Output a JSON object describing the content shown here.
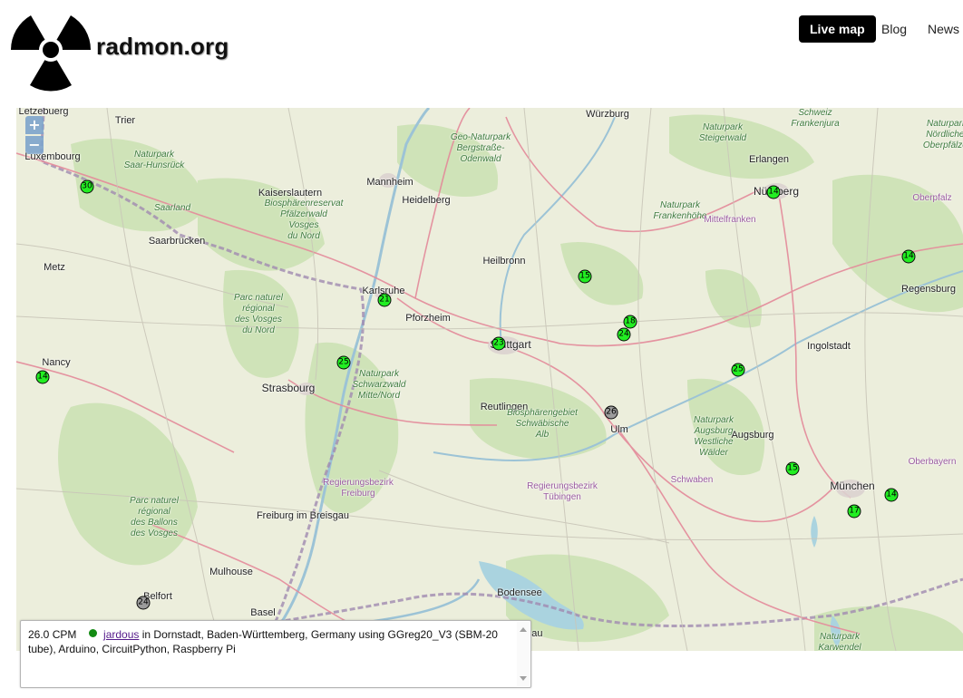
{
  "header": {
    "site_title": "radmon.org",
    "logo_icon": "radiation-trefoil-icon",
    "nav": [
      {
        "label": "Live map",
        "active": true
      },
      {
        "label": "Blog",
        "active": false
      },
      {
        "label": "News",
        "active": false
      }
    ]
  },
  "map": {
    "zoom_in_label": "+",
    "zoom_out_label": "−",
    "labels": [
      {
        "text": "Luxembourg",
        "kind": "city"
      },
      {
        "text": "Trier",
        "kind": "city"
      },
      {
        "text": "Würzburg",
        "kind": "city"
      },
      {
        "text": "Naturpark\nSaar-Hunsrück",
        "kind": "park"
      },
      {
        "text": "Saarland",
        "kind": "park"
      },
      {
        "text": "Geo-Naturpark\nBergstraße-\nOdenwald",
        "kind": "park"
      },
      {
        "text": "Kaiserslautern",
        "kind": "city"
      },
      {
        "text": "Mannheim",
        "kind": "city"
      },
      {
        "text": "Heidelberg",
        "kind": "city"
      },
      {
        "text": "Biosphärenreservat\nPfälzerwald\nVosges\ndu Nord",
        "kind": "park"
      },
      {
        "text": "Saarbrücken",
        "kind": "city"
      },
      {
        "text": "Metz",
        "kind": "city"
      },
      {
        "text": "Heilbronn",
        "kind": "city"
      },
      {
        "text": "Parc naturel\nrégional\ndes Vosges\ndu Nord",
        "kind": "park"
      },
      {
        "text": "Karlsruhe",
        "kind": "city"
      },
      {
        "text": "Pforzheim",
        "kind": "city"
      },
      {
        "text": "Stuttgart",
        "kind": "big"
      },
      {
        "text": "Nancy",
        "kind": "city"
      },
      {
        "text": "Strasbourg",
        "kind": "big"
      },
      {
        "text": "Naturpark\nSchwarzwald\nMitte/Nord",
        "kind": "park"
      },
      {
        "text": "Reutlingen",
        "kind": "city"
      },
      {
        "text": "Biosphärengebiet\nSchwäbische\nAlb",
        "kind": "park"
      },
      {
        "text": "Ulm",
        "kind": "city"
      },
      {
        "text": "Regierungsbezirk\nFreiburg",
        "kind": "region"
      },
      {
        "text": "Regierungsbezirk\nTübingen",
        "kind": "region"
      },
      {
        "text": "Parc naturel\nrégional\ndes Ballons\ndes Vosges",
        "kind": "park"
      },
      {
        "text": "Freiburg\nim Breisgau",
        "kind": "city"
      },
      {
        "text": "Mulhouse",
        "kind": "city"
      },
      {
        "text": "Belfort",
        "kind": "city"
      },
      {
        "text": "Basel",
        "kind": "city"
      },
      {
        "text": "Erlangen",
        "kind": "city"
      },
      {
        "text": "Nürnberg",
        "kind": "big"
      },
      {
        "text": "Naturpark\nSteigerwald",
        "kind": "park"
      },
      {
        "text": "Schweiz\nFrankenjura",
        "kind": "park"
      },
      {
        "text": "Naturpark\nFrankenhöhe",
        "kind": "park"
      },
      {
        "text": "Mittelfranken",
        "kind": "region"
      },
      {
        "text": "Regensburg",
        "kind": "city"
      },
      {
        "text": "Ingolstadt",
        "kind": "city"
      },
      {
        "text": "Naturpark\nAugsburg\nWestliche\nWälder",
        "kind": "park"
      },
      {
        "text": "Augsburg",
        "kind": "city"
      },
      {
        "text": "Schwaben",
        "kind": "region"
      },
      {
        "text": "München",
        "kind": "big"
      },
      {
        "text": "Oberbayern",
        "kind": "region"
      },
      {
        "text": "Naturpark\nKarwendel",
        "kind": "park"
      },
      {
        "text": "Bodensee",
        "kind": "city"
      },
      {
        "text": "Thurgau",
        "kind": "city"
      },
      {
        "text": "Naturpark\nNördlicher\nOberpfälzer",
        "kind": "park"
      },
      {
        "text": "Oberpfalz",
        "kind": "region"
      },
      {
        "text": "Letzebuerg",
        "kind": "city"
      }
    ],
    "markers": [
      {
        "value": "30",
        "status": "green"
      },
      {
        "value": "14",
        "status": "green"
      },
      {
        "value": "21",
        "status": "green"
      },
      {
        "value": "25",
        "status": "green"
      },
      {
        "value": "23",
        "status": "green"
      },
      {
        "value": "15",
        "status": "green"
      },
      {
        "value": "18",
        "status": "green"
      },
      {
        "value": "24",
        "status": "green"
      },
      {
        "value": "26",
        "status": "grey"
      },
      {
        "value": "25",
        "status": "green"
      },
      {
        "value": "14",
        "status": "green"
      },
      {
        "value": "14",
        "status": "green"
      },
      {
        "value": "15",
        "status": "green"
      },
      {
        "value": "17",
        "status": "green"
      },
      {
        "value": "14",
        "status": "green"
      },
      {
        "value": "24",
        "status": "grey"
      }
    ],
    "colors": {
      "marker_green": "#22ee22",
      "marker_grey": "#9c9c9c",
      "lake": "#aad3df",
      "forest": "#cfe3b8"
    }
  },
  "info_box": {
    "cpm": "26.0 CPM",
    "status_color": "#138b13",
    "user_link": "jardous",
    "description": "in Dornstadt, Baden-Württemberg, Germany using GGreg20_V3 (SBM-20 tube), Arduino, CircuitPython, Raspberry Pi"
  }
}
